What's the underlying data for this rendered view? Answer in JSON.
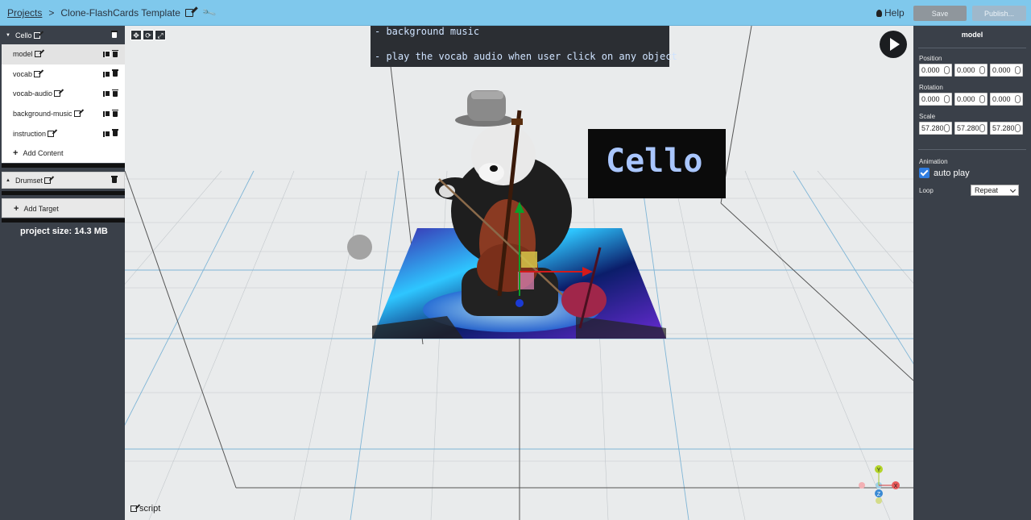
{
  "header": {
    "projects_link": "Projects",
    "separator": ">",
    "project_name": "Clone-FlashCards Template",
    "help_label": "Help",
    "save_label": "Save",
    "publish_label": "Publish..."
  },
  "sidebar": {
    "targets": [
      {
        "name": "Cello",
        "expanded": true,
        "contents": [
          "model",
          "vocab",
          "vocab-audio",
          "background-music",
          "instruction"
        ],
        "add_content_label": "Add Content"
      },
      {
        "name": "Drumset",
        "expanded": false
      }
    ],
    "add_target_label": "Add Target",
    "project_size": "project size: 14.3 MB"
  },
  "viewport": {
    "instruction_lines": [
      "- background music",
      "- play the vocab audio when user click on any object"
    ],
    "vocab_card_text": "Cello",
    "script_label": "script",
    "gizmo_labels": {
      "y": "Y",
      "x": "X",
      "z": "Z"
    }
  },
  "inspector": {
    "title": "model",
    "position_label": "Position",
    "position": [
      "0.000",
      "0.000",
      "0.000"
    ],
    "rotation_label": "Rotation",
    "rotation": [
      "0.000",
      "0.000",
      "0.000"
    ],
    "scale_label": "Scale",
    "scale": [
      "57.280",
      "57.280",
      "57.280"
    ],
    "animation_label": "Animation",
    "autoplay_label": "auto play",
    "autoplay_checked": true,
    "loop_label": "Loop",
    "loop_value": "Repeat"
  },
  "colors": {
    "topbar": "#7fc8ec",
    "panel": "#3a4049",
    "viewport_bg": "#e9ebec",
    "card_text": "#a9c6ff"
  }
}
